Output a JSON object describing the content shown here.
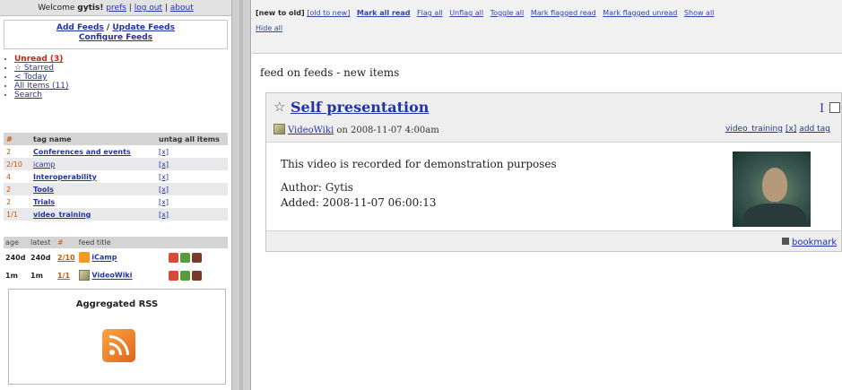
{
  "sidebar": {
    "welcome": {
      "prefix": "Welcome ",
      "user": "gytis",
      "bang": "!",
      "prefs": "prefs",
      "logout": "log out",
      "about": "about",
      "sep": " | "
    },
    "add_feeds": "Add Feeds",
    "slash": " / ",
    "update_feeds": "Update Feeds",
    "configure_feeds": "Configure Feeds",
    "nav": {
      "unread": "Unread (3)",
      "starred": "☆ Starred",
      "today": "< Today",
      "all_items": "All Items (11)",
      "search": "Search"
    },
    "tags_table": {
      "headers": {
        "count": "#",
        "name": "tag name",
        "untag": "untag all items"
      },
      "rows": [
        {
          "count": "2",
          "name": "Conferences and events",
          "untag": "[x]"
        },
        {
          "count": "2/10",
          "name": "icamp",
          "untag": "[x]"
        },
        {
          "count": "4",
          "name": "Interoperability",
          "untag": "[x]"
        },
        {
          "count": "2",
          "name": "Tools",
          "untag": "[x]"
        },
        {
          "count": "2",
          "name": "Trials",
          "untag": "[x]"
        },
        {
          "count": "1/1",
          "name": "video_training",
          "untag": "[x]"
        }
      ]
    },
    "feeds_table": {
      "headers": {
        "age": "age",
        "latest": "latest",
        "count": "#",
        "feed": "feed title"
      },
      "rows": [
        {
          "age": "240d",
          "latest": "240d",
          "count": "2/10",
          "icon": "rss-feed-icon",
          "title": "iCamp"
        },
        {
          "age": "1m",
          "latest": "1m",
          "count": "1/1",
          "icon": "videowiki-feed-icon",
          "title": "VideoWiki"
        }
      ]
    },
    "aggregated_rss": "Aggregated RSS"
  },
  "toolbar": {
    "new_to_old": "[new to old]",
    "old_to_new": "[old to new]",
    "mark_all_read": "Mark all read",
    "flag_all": "Flag all",
    "unflag_all": "Unflag all",
    "toggle_all": "Toggle all",
    "mark_flagged_read": "Mark flagged read",
    "mark_flagged_unread": "Mark flagged unread",
    "show_all": "Show all",
    "hide_all": "Hide all"
  },
  "main": {
    "heading": "feed on feeds - new items",
    "item": {
      "star": "☆",
      "title": "Self presentation",
      "source": "VideoWiki",
      "date_text": " on 2008-11-07 4:00am",
      "mark_i": "I",
      "tag": "video_training",
      "tag_remove": "[x]",
      "add_tag": "add tag",
      "description": "This video is recorded for demonstration purposes",
      "author": "Author: Gytis",
      "added": "Added: 2008-11-07 06:00:13",
      "bookmark": "bookmark"
    }
  },
  "colors": {
    "link": "#2233aa",
    "unread_red": "#cc2211",
    "count_orange": "#cc5500",
    "rss_orange": "#f39a21",
    "header_grey": "#d4d4d4"
  }
}
